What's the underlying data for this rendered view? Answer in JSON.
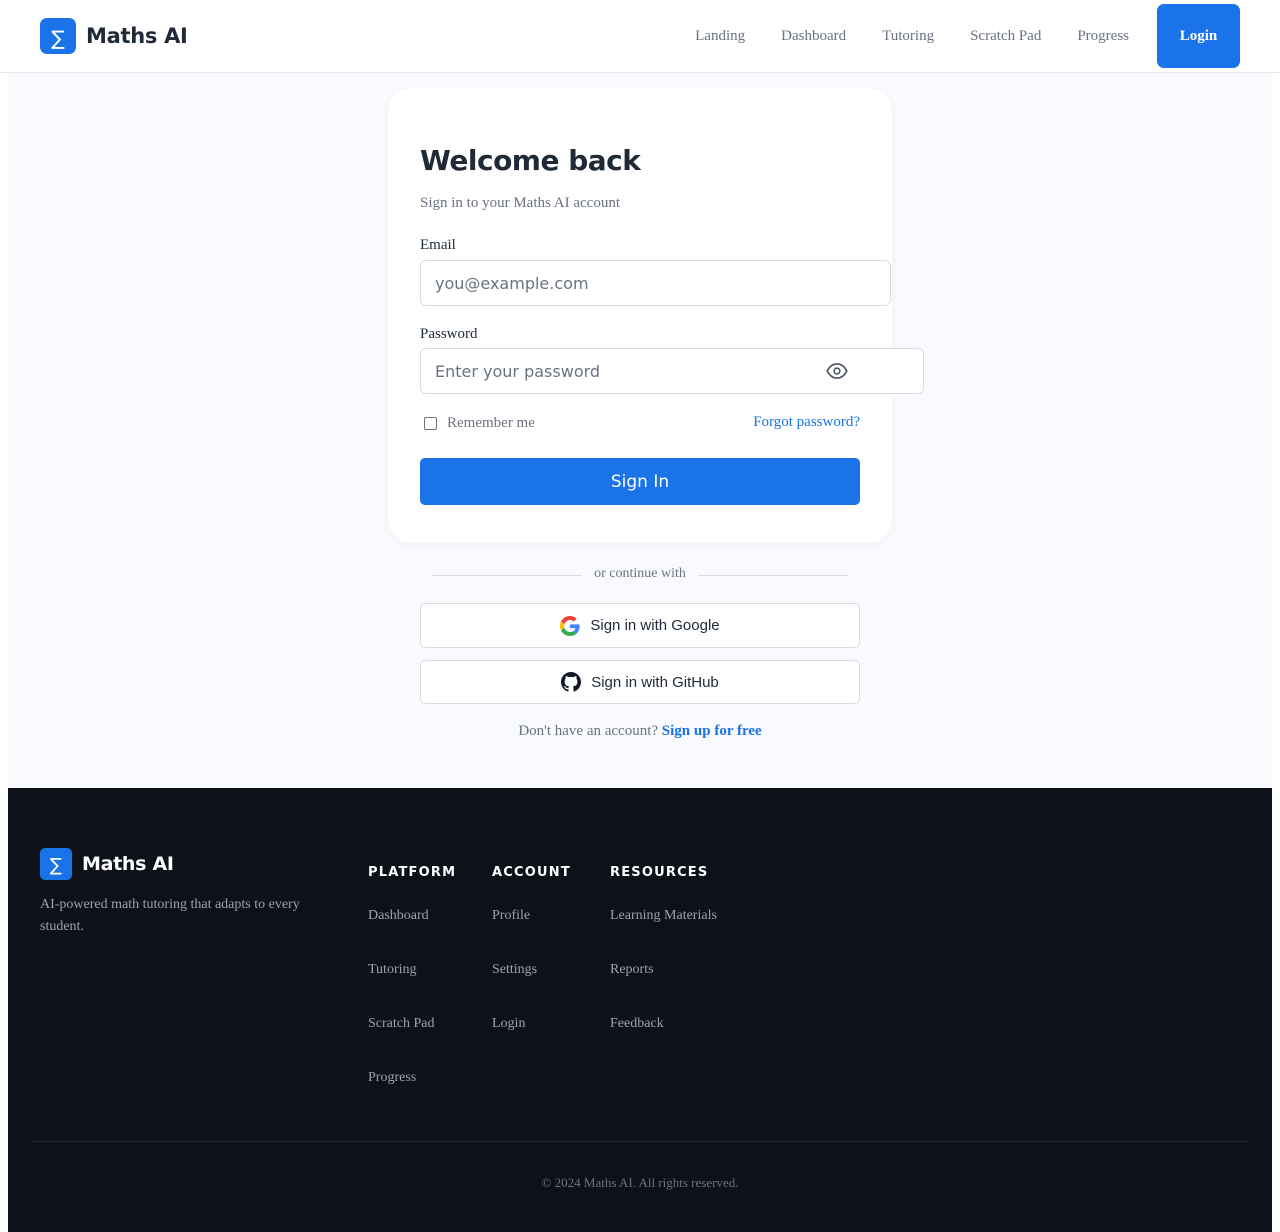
{
  "brand": {
    "logo_symbol": "∑",
    "name": "Maths AI"
  },
  "nav": {
    "links": [
      "Landing",
      "Dashboard",
      "Tutoring",
      "Scratch Pad",
      "Progress"
    ],
    "login_label": "Login"
  },
  "login_card": {
    "title": "Welcome back",
    "subtitle": "Sign in to your Maths AI account",
    "email_label": "Email",
    "email_placeholder": "you@example.com",
    "password_label": "Password",
    "password_placeholder": "Enter your password",
    "password_toggle_icon": "eye-icon",
    "remember_label": "Remember me",
    "remember_checked": false,
    "forgot_label": "Forgot password?",
    "signin_label": "Sign In"
  },
  "divider_text": "or continue with",
  "oauth": {
    "google_label": "Sign in with Google",
    "google_icon": "google-icon",
    "github_label": "Sign in with GitHub",
    "github_icon": "github-icon"
  },
  "signup": {
    "prompt": "Don't have an account?",
    "link": "Sign up for free"
  },
  "footer": {
    "logo_symbol": "∑",
    "name": "Maths AI",
    "tagline": "AI-powered math tutoring that adapts to every student.",
    "columns": [
      {
        "heading": "PLATFORM",
        "links": [
          "Dashboard",
          "Tutoring",
          "Scratch Pad",
          "Progress"
        ]
      },
      {
        "heading": "ACCOUNT",
        "links": [
          "Profile",
          "Settings",
          "Login"
        ]
      },
      {
        "heading": "RESOURCES",
        "links": [
          "Learning Materials",
          "Reports",
          "Feedback"
        ]
      }
    ],
    "copyright": "© 2024 Maths AI. All rights reserved."
  },
  "colors": {
    "accent": "#1a73e8",
    "footer_bg": "#0d111a",
    "page_bg": "#f8fafd"
  }
}
